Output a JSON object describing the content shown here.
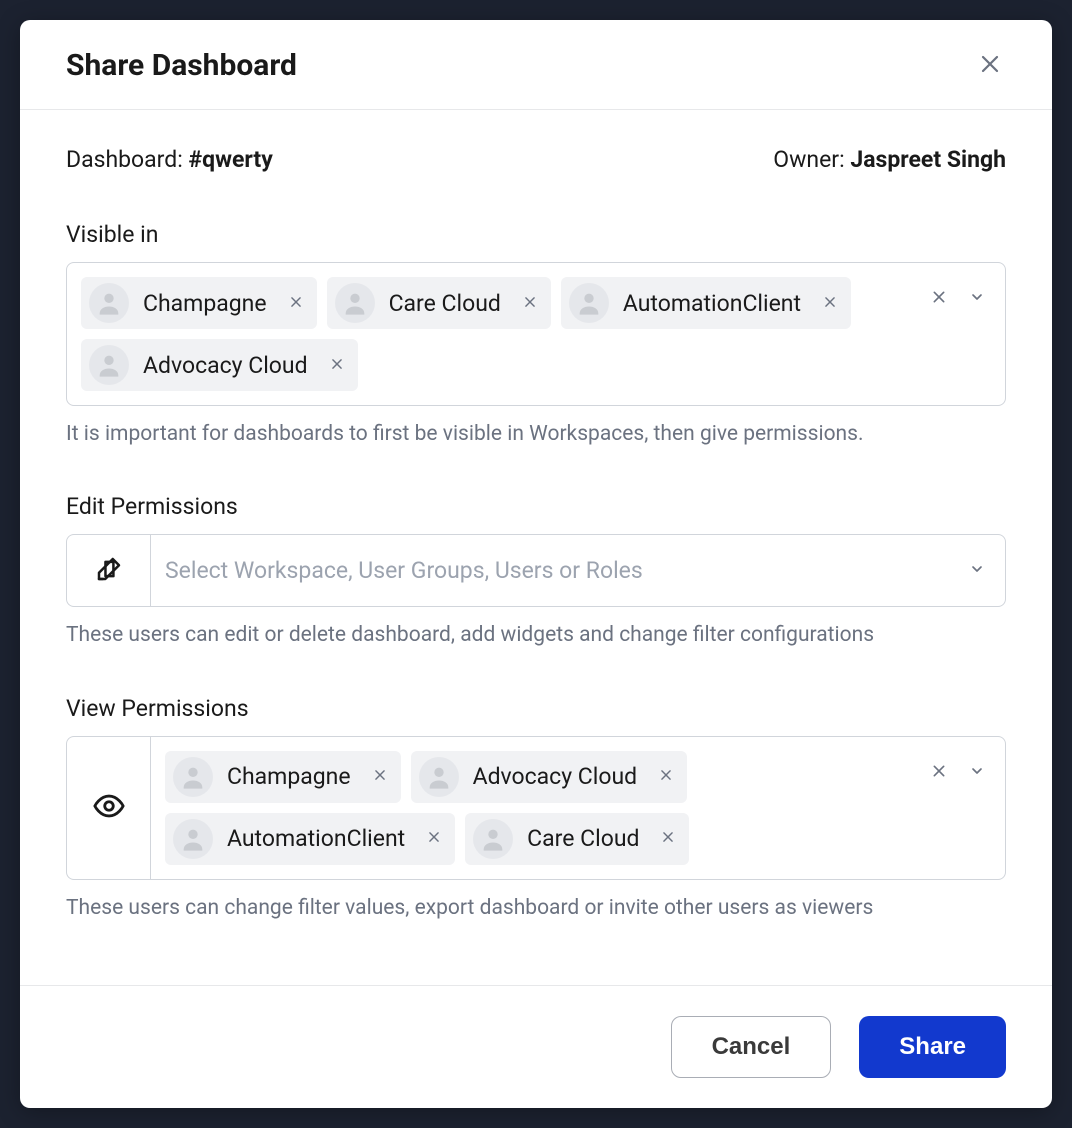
{
  "modal": {
    "title": "Share Dashboard",
    "dashboardLabel": "Dashboard: ",
    "dashboardName": "#qwerty",
    "ownerLabel": "Owner: ",
    "ownerName": "Jaspreet Singh"
  },
  "visibleIn": {
    "label": "Visible in",
    "chips": [
      "Champagne",
      "Care Cloud",
      "AutomationClient",
      "Advocacy Cloud"
    ],
    "help": "It is important for dashboards to first be visible in Workspaces, then give permissions."
  },
  "editPermissions": {
    "label": "Edit Permissions",
    "placeholder": "Select Workspace, User Groups, Users or Roles",
    "help": "These users can edit or delete dashboard, add widgets and change filter configurations"
  },
  "viewPermissions": {
    "label": "View Permissions",
    "chips": [
      "Champagne",
      "Advocacy Cloud",
      "AutomationClient",
      "Care Cloud"
    ],
    "help": "These users can change filter values, export dashboard or invite other users as viewers"
  },
  "footer": {
    "cancel": "Cancel",
    "share": "Share"
  }
}
